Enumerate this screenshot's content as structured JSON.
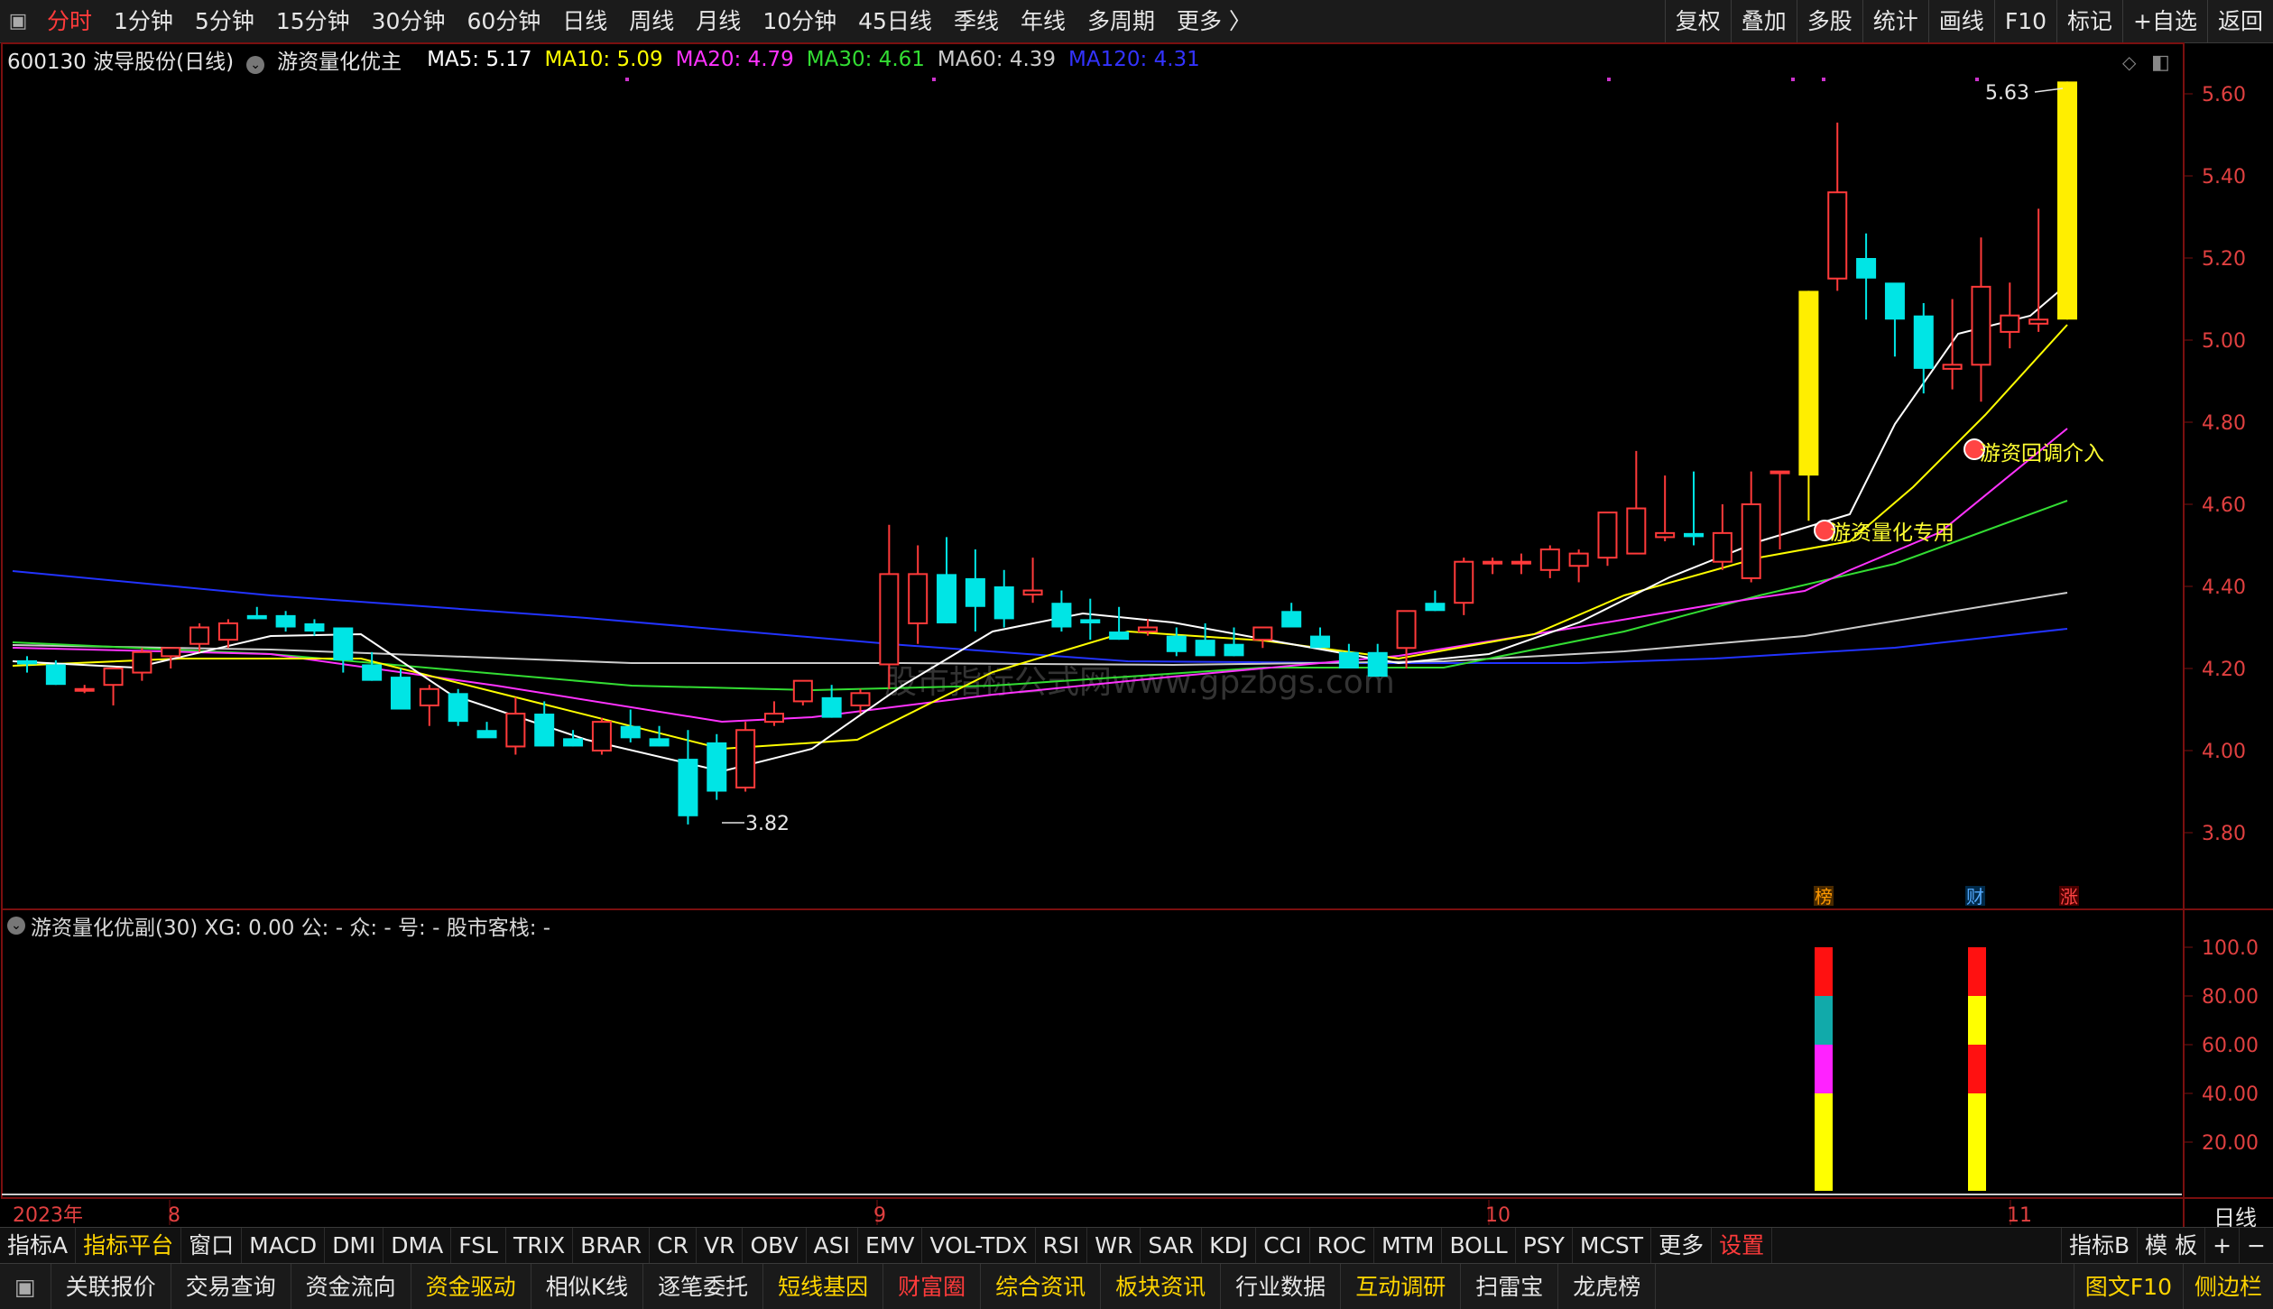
{
  "toolbar": {
    "periods": [
      "分时",
      "1分钟",
      "5分钟",
      "15分钟",
      "30分钟",
      "60分钟",
      "日线",
      "周线",
      "月线",
      "10分钟",
      "45日线",
      "季线",
      "年线",
      "多周期",
      "更多 〉"
    ],
    "active_index": 0,
    "right": [
      "复权",
      "叠加",
      "多股",
      "统计",
      "画线",
      "F10",
      "标记",
      "+自选",
      "返回"
    ]
  },
  "main": {
    "stock": "600130 波导股份(日线)",
    "indicator": "游资量化优主",
    "ma": [
      {
        "label": "MA5: 5.17",
        "color": "#ffffff"
      },
      {
        "label": "MA10: 5.09",
        "color": "#ffff00"
      },
      {
        "label": "MA20: 4.79",
        "color": "#ff33ff"
      },
      {
        "label": "MA30: 4.61",
        "color": "#33dd33"
      },
      {
        "label": "MA60: 4.39",
        "color": "#cccccc"
      },
      {
        "label": "MA120: 4.31",
        "color": "#3333ff"
      }
    ],
    "price_axis": [
      "5.60",
      "5.40",
      "5.20",
      "5.00",
      "4.80",
      "4.60",
      "4.40",
      "4.20",
      "4.00",
      "3.80"
    ],
    "high_label": "5.63",
    "low_label": "3.82",
    "annotation_1": "游资量化专用",
    "annotation_2": "游资回调介入",
    "watermark": "股市指标公式网www.gpzbgs.com",
    "markers": [
      "榜",
      "财",
      "涨"
    ]
  },
  "sub": {
    "header": "游资量化优副(30)  XG: 0.00  公: -  众: -  号: -  股市客栈: -",
    "axis": [
      "100.0",
      "80.00",
      "60.00",
      "40.00",
      "20.00"
    ]
  },
  "time_axis": {
    "year": "2023年",
    "months": [
      "8",
      "9",
      "10",
      "11"
    ],
    "period": "日线"
  },
  "indicator_tabs": [
    "指标A",
    "指标平台",
    "窗口",
    "MACD",
    "DMI",
    "DMA",
    "FSL",
    "TRIX",
    "BRAR",
    "CR",
    "VR",
    "OBV",
    "ASI",
    "EMV",
    "VOL-TDX",
    "RSI",
    "WR",
    "SAR",
    "KDJ",
    "CCI",
    "ROC",
    "MTM",
    "BOLL",
    "PSY",
    "MCST",
    "更多",
    "设置"
  ],
  "indicator_tabs_right": [
    "指标B",
    "模 板",
    "+",
    "−"
  ],
  "func_bar": [
    {
      "label": "关联报价",
      "color": "#e6e6e6"
    },
    {
      "label": "交易查询",
      "color": "#e6e6e6"
    },
    {
      "label": "资金流向",
      "color": "#e6e6e6"
    },
    {
      "label": "资金驱动",
      "color": "#ffd400"
    },
    {
      "label": "相似K线",
      "color": "#e6e6e6"
    },
    {
      "label": "逐笔委托",
      "color": "#e6e6e6"
    },
    {
      "label": "短线基因",
      "color": "#ffd400"
    },
    {
      "label": "财富圈",
      "color": "#ff3b3b"
    },
    {
      "label": "综合资讯",
      "color": "#ffd400"
    },
    {
      "label": "板块资讯",
      "color": "#ffd400"
    },
    {
      "label": "行业数据",
      "color": "#e6e6e6"
    },
    {
      "label": "互动调研",
      "color": "#ffd400"
    },
    {
      "label": "扫雷宝",
      "color": "#e6e6e6"
    },
    {
      "label": "龙虎榜",
      "color": "#e6e6e6"
    }
  ],
  "func_bar_right": [
    "图文F10",
    "侧边栏"
  ]
}
